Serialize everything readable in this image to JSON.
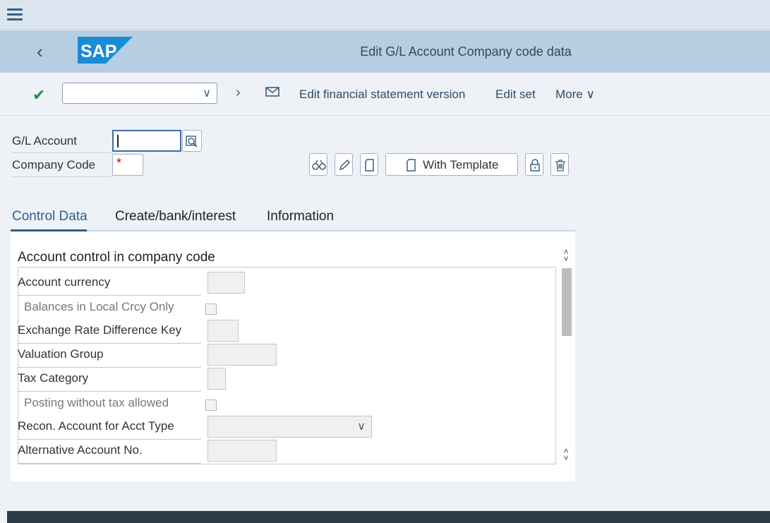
{
  "window": {
    "title": "Edit G/L Account Company code data"
  },
  "toolbar": {
    "command_value": "",
    "links": [
      "Edit financial statement version",
      "Edit set",
      "More"
    ]
  },
  "header_fields": {
    "gl_account_label": "G/L Account",
    "gl_account_value": "",
    "company_code_label": "Company Code",
    "company_code_required": "*",
    "template_button": "With Template"
  },
  "tabs": [
    "Control Data",
    "Create/bank/interest",
    "Information"
  ],
  "active_tab": "Control Data",
  "section": {
    "title": "Account control in company code",
    "rows": [
      {
        "label": "Account currency",
        "type": "input",
        "enabled": true
      },
      {
        "label": "Balances in Local Crcy Only",
        "type": "checkbox",
        "enabled": false
      },
      {
        "label": "Exchange Rate Difference Key",
        "type": "input",
        "enabled": true
      },
      {
        "label": "Valuation Group",
        "type": "input",
        "enabled": true
      },
      {
        "label": "Tax Category",
        "type": "input",
        "enabled": true
      },
      {
        "label": "Posting without tax allowed",
        "type": "checkbox",
        "enabled": false
      },
      {
        "label": "Recon. Account for Acct Type",
        "type": "dropdown",
        "enabled": true
      },
      {
        "label": "Alternative Account No.",
        "type": "input",
        "enabled": true
      }
    ]
  },
  "colors": {
    "shell_title": "#b6cde2",
    "menubar": "#dbe5ef",
    "accent": "#2d5e8e",
    "required": "#cc0000"
  }
}
